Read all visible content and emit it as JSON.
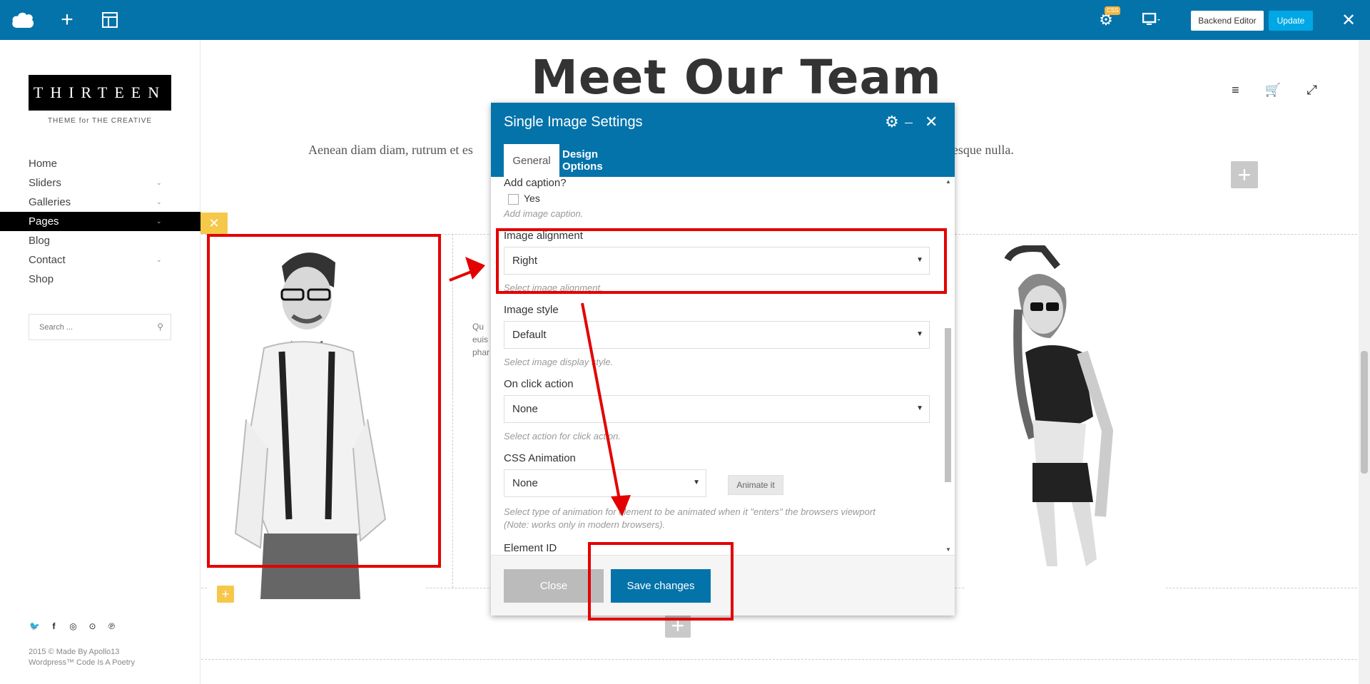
{
  "toolbar": {
    "css_badge": "CSS",
    "backend_editor_label": "Backend Editor",
    "update_label": "Update"
  },
  "sidebar": {
    "logo_text": "THIRTEEN",
    "logo_tagline": "THEME for THE CREATIVE",
    "nav": [
      {
        "label": "Home"
      },
      {
        "label": "Sliders"
      },
      {
        "label": "Galleries"
      },
      {
        "label": "Pages"
      },
      {
        "label": "Blog"
      },
      {
        "label": "Contact"
      },
      {
        "label": "Shop"
      }
    ],
    "search_placeholder": "Search ...",
    "social_icons": [
      "twitter-icon",
      "facebook-icon",
      "dribbble-icon",
      "flickr-icon",
      "pinterest-icon"
    ],
    "footer_line1": "2015 © Made By Apollo13",
    "footer_line2": "Wordpress™ Code Is A Poetry"
  },
  "main": {
    "title": "Meet Our Team",
    "intro_left": "Aenean diam diam, rutrum et es",
    "intro_right": "llentesque nulla.",
    "partial_lines": [
      "Qu",
      "euis",
      "phar"
    ]
  },
  "modal": {
    "title": "Single Image Settings",
    "tabs": [
      "General",
      "Design Options"
    ],
    "caption": {
      "label": "Add caption?",
      "checkbox_label": "Yes",
      "hint": "Add image caption."
    },
    "alignment": {
      "label": "Image alignment",
      "value": "Right",
      "hint": "Select image alignment."
    },
    "style": {
      "label": "Image style",
      "value": "Default",
      "hint": "Select image display style."
    },
    "click_action": {
      "label": "On click action",
      "value": "None",
      "hint": "Select action for click action."
    },
    "animation": {
      "label": "CSS Animation",
      "value": "None",
      "button": "Animate it",
      "hint1": "Select type of animation for element to be animated when it \"enters\" the browsers viewport",
      "hint2": "(Note: works only in modern browsers)."
    },
    "element_id_label": "Element ID",
    "close_label": "Close",
    "save_label": "Save changes"
  },
  "colors": {
    "brand_blue": "#0473aa",
    "update_blue": "#00a7e5",
    "annotation_red": "#e30000",
    "yellow": "#f6c84a"
  }
}
